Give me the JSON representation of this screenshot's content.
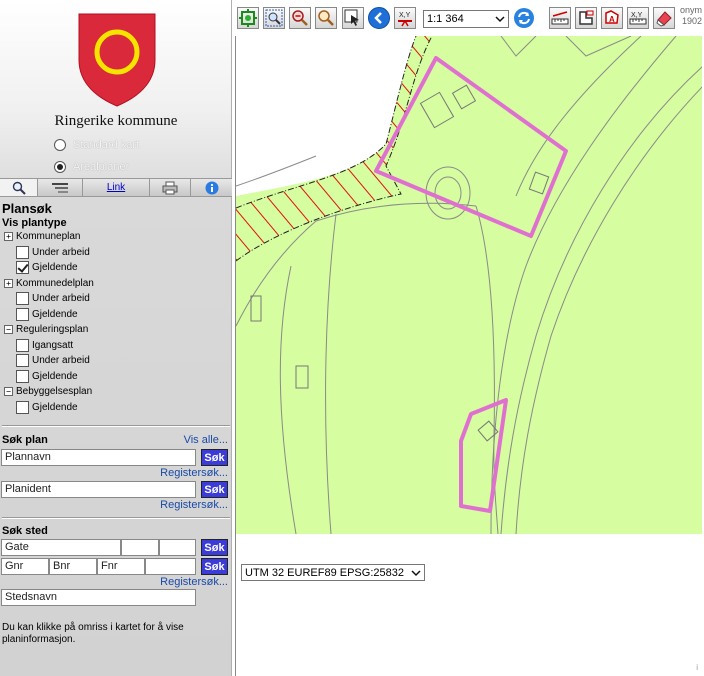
{
  "municipality": "Ringerike kommune",
  "map_types": [
    {
      "label": "Standard kart",
      "selected": false
    },
    {
      "label": "Arealplaner",
      "selected": true
    }
  ],
  "tabs": [
    {
      "icon": "search-icon"
    },
    {
      "icon": "layers-icon"
    },
    {
      "label": "Link"
    },
    {
      "icon": "printer-icon"
    },
    {
      "icon": "info-icon"
    }
  ],
  "plansok": {
    "title": "Plansøk",
    "vis_plantype": "Vis plantype",
    "groups": [
      {
        "name": "Kommuneplan",
        "toggle": "+",
        "items": [
          {
            "label": "Under arbeid",
            "checked": false
          },
          {
            "label": "Gjeldende",
            "checked": true
          }
        ]
      },
      {
        "name": "Kommunedelplan",
        "toggle": "+",
        "items": [
          {
            "label": "Under arbeid",
            "checked": false
          },
          {
            "label": "Gjeldende",
            "checked": false
          }
        ]
      },
      {
        "name": "Reguleringsplan",
        "toggle": "−",
        "items": [
          {
            "label": "Igangsatt",
            "checked": false
          },
          {
            "label": "Under arbeid",
            "checked": false
          },
          {
            "label": "Gjeldende",
            "checked": false
          }
        ]
      },
      {
        "name": "Bebyggelsesplan",
        "toggle": "−",
        "items": [
          {
            "label": "Gjeldende",
            "checked": false
          }
        ]
      }
    ]
  },
  "sok_plan": {
    "title": "Søk plan",
    "vis_alle": "Vis alle...",
    "plannavn_value": "Plannavn",
    "planident_value": "Planident",
    "sok_label": "Søk",
    "register_label": "Registersøk..."
  },
  "sok_sted": {
    "title": "Søk sted",
    "gate_value": "Gate",
    "gnr_value": "Gnr",
    "bnr_value": "Bnr",
    "fnr_value": "Fnr",
    "stedsnavn_value": "Stedsnavn",
    "sok_label": "Søk",
    "register_label": "Registersøk..."
  },
  "hint": "Du kan klikke på omriss i kartet for å vise planinformasjon.",
  "toolbar": {
    "scale": "1:1 364",
    "corner_line1": "onym",
    "corner_line2": "1902"
  },
  "crs": "UTM 32 EUREF89 EPSG:25832",
  "footer_mark": "i",
  "colors": {
    "map_green": "#d6fd9f",
    "plan_outline": "#e070d0",
    "hatch_red": "#e01010",
    "sok_button": "#3b3bd8",
    "link_blue": "#1a4aa6"
  }
}
